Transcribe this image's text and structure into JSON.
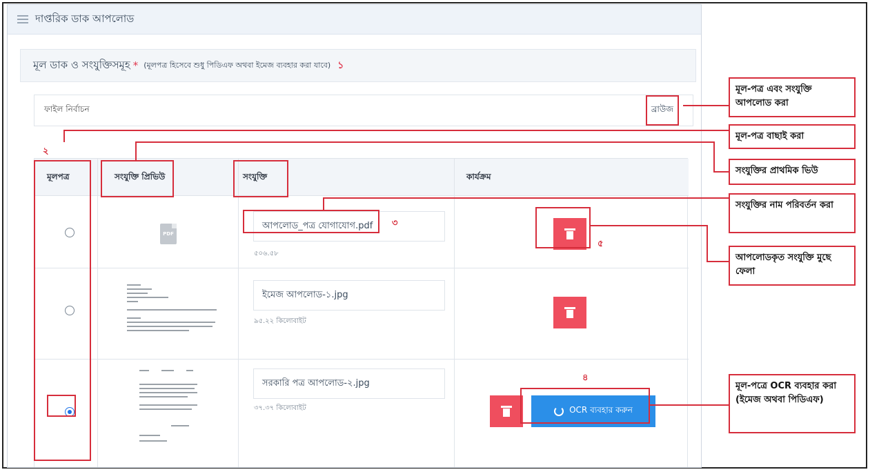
{
  "panel": {
    "title": "দাপ্তরিক ডাক আপলোড"
  },
  "sub_header": {
    "label": "মূল ডাক ও সংযুক্তিসমূহ",
    "required": "*",
    "note": "(মূলপত্র হিসেবে শুধু পিডিএফ অথবা ইমেজ ব্যবহার করা যাবে)",
    "marker": "১"
  },
  "file_select": {
    "placeholder": "ফাইল নির্বাচন",
    "browse_label": "ব্রাউজ"
  },
  "table": {
    "headers": {
      "main_letter": "মূলপত্র",
      "preview": "সংযুক্তি প্রিভিউ",
      "attachment": "সংযুক্তি",
      "action": "কার্যক্রম"
    },
    "rows": [
      {
        "filename": "আপলোড_পত্র যোগাযোগ.pdf",
        "size": "৫০৬.৫৮",
        "selected": false,
        "preview_type": "pdf-icon",
        "pdf_label": "PDF"
      },
      {
        "filename": "ইমেজ আপলোড-১.jpg",
        "size": "৯৫.২২ কিলোবাইট",
        "selected": false,
        "preview_type": "document-thumbnail"
      },
      {
        "filename": "সরকারি পত্র আপলোড-২.jpg",
        "size": "৩৭.৩৭ কিলোবাইট",
        "selected": true,
        "preview_type": "document-thumbnail"
      }
    ],
    "ocr_button_label": "OCR ব্যবহার করুন"
  },
  "markers": {
    "two": "২",
    "three": "৩",
    "four": "৪",
    "five": "৫"
  },
  "callouts": {
    "upload": "মূল-পত্র এবং সংযুক্তি আপলোড করা",
    "choose_main": "মূল-পত্র বাছাই করা",
    "preview": "সংযুক্তির প্রাথমিক ভিউ",
    "rename": "সংযুক্তির নাম পরিবর্তন করা",
    "delete": "আপলোডকৃত সংযুক্তি মুছে ফেলা",
    "ocr": "মূল-পত্রে OCR ব্যবহার করা (ইমেজ অথবা পিডিএফ)"
  },
  "colors": {
    "accent_red": "#d62d3b",
    "delete_button": "#ef4e5e",
    "ocr_blue": "#2b8fe8",
    "radio_blue": "#1e73e8"
  }
}
